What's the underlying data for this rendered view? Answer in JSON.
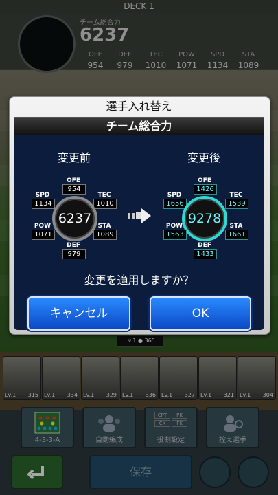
{
  "deck_title": "DECK 1",
  "team_total_label": "チーム総合力",
  "team_total_value": "6237",
  "header_stats": [
    {
      "label": "OFE",
      "value": "954"
    },
    {
      "label": "DEF",
      "value": "979"
    },
    {
      "label": "TEC",
      "value": "1010"
    },
    {
      "label": "POW",
      "value": "1071"
    },
    {
      "label": "SPD",
      "value": "1134"
    },
    {
      "label": "STA",
      "value": "1089"
    }
  ],
  "dialog": {
    "title": "選手入れ替え",
    "subheader": "チーム総合力",
    "before": {
      "title": "変更前",
      "total": "6237",
      "OFE": "954",
      "TEC": "1010",
      "STA": "1089",
      "DEF": "979",
      "POW": "1071",
      "SPD": "1134"
    },
    "after": {
      "title": "変更後",
      "total": "9278",
      "OFE": "1426",
      "TEC": "1539",
      "STA": "1661",
      "DEF": "1433",
      "POW": "1563",
      "SPD": "1656"
    },
    "labels": {
      "OFE": "OFE",
      "TEC": "TEC",
      "STA": "STA",
      "DEF": "DEF",
      "POW": "POW",
      "SPD": "SPD"
    },
    "question": "変更を適用しますか？",
    "cancel_label": "キャンセル",
    "ok_label": "OK"
  },
  "level_badge": {
    "lv": "Lv.1",
    "power": "365"
  },
  "player_cards": [
    {
      "lv": "Lv.1",
      "power": "315"
    },
    {
      "lv": "Lv.1",
      "power": "334"
    },
    {
      "lv": "Lv.1",
      "power": "329"
    },
    {
      "lv": "Lv.1",
      "power": "336"
    },
    {
      "lv": "Lv.1",
      "power": "327"
    },
    {
      "lv": "Lv.1",
      "power": "321"
    },
    {
      "lv": "Lv.1",
      "power": "304"
    }
  ],
  "nav": {
    "formation": "4-3-3-A",
    "auto": "自動編成",
    "roles": "役割設定",
    "bench": "控え選手",
    "save": "保存",
    "role_tags": [
      "CPT",
      "PK",
      "CK",
      "FK"
    ]
  },
  "colors": {
    "accent": "#2fd8d3",
    "button": "#1463e6",
    "dialog_bg": "#0c1c3d"
  }
}
